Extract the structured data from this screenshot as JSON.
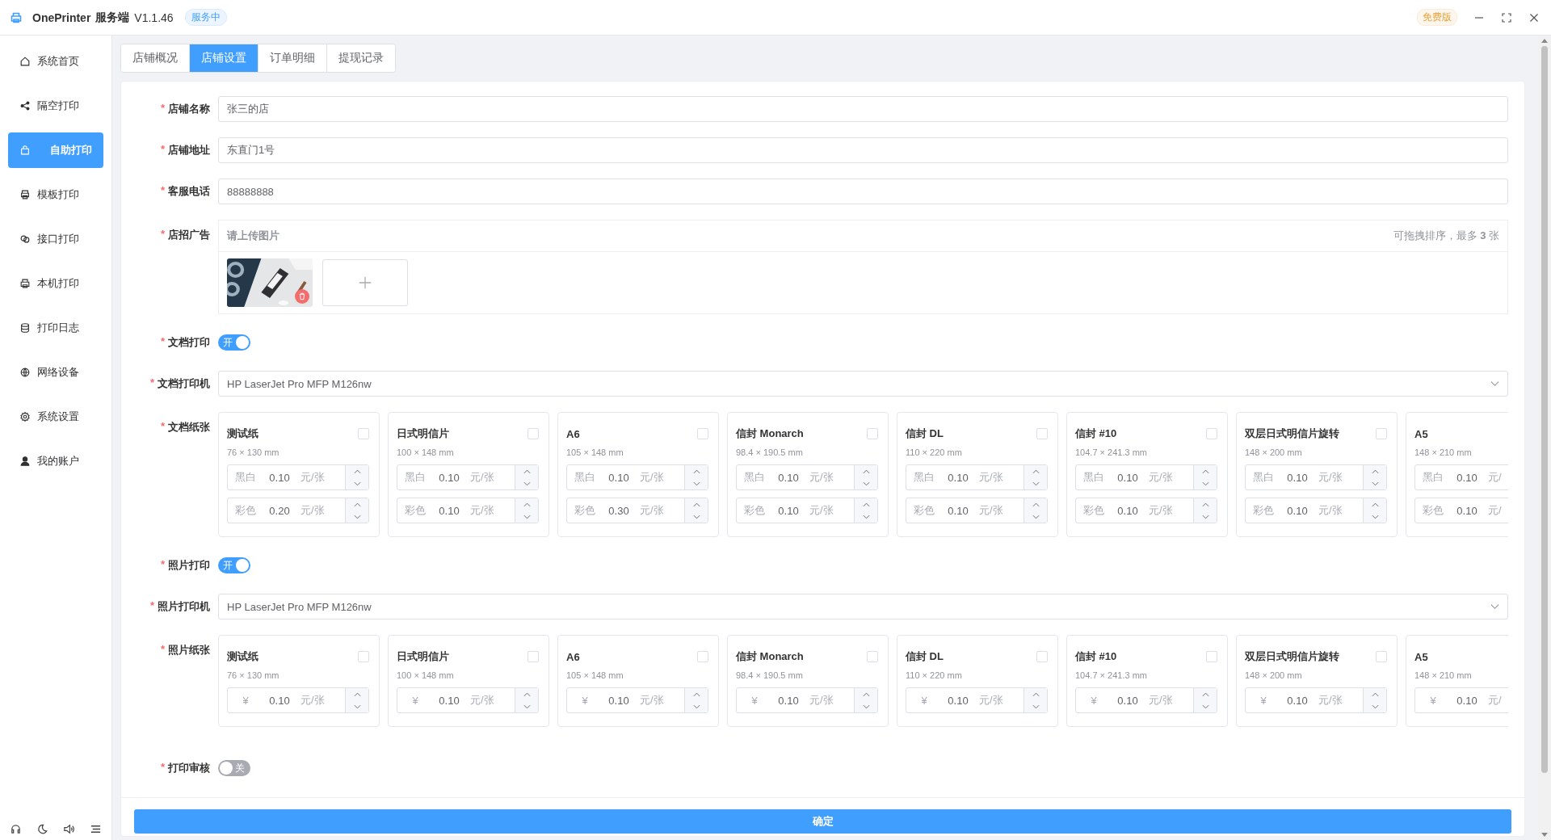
{
  "app": {
    "title": "OnePrinter",
    "subtitle": "服务端",
    "version": "V1.1.46",
    "status": "服务中",
    "edition": "免费版"
  },
  "sidebar": {
    "items": [
      {
        "kind": "home",
        "label": "系统首页",
        "selected": false
      },
      {
        "kind": "share",
        "label": "隔空打印",
        "selected": false
      },
      {
        "kind": "bag",
        "label": "自助打印",
        "selected": true
      },
      {
        "kind": "template",
        "label": "模板打印",
        "selected": false
      },
      {
        "kind": "link",
        "label": "接口打印",
        "selected": false
      },
      {
        "kind": "printer",
        "label": "本机打印",
        "selected": false
      },
      {
        "kind": "database",
        "label": "打印日志",
        "selected": false
      },
      {
        "kind": "network",
        "label": "网络设备",
        "selected": false
      },
      {
        "kind": "gear",
        "label": "系统设置",
        "selected": false
      },
      {
        "kind": "user",
        "label": "我的账户",
        "selected": false
      }
    ]
  },
  "tabs": [
    {
      "label": "店铺概况",
      "selected": false
    },
    {
      "label": "店铺设置",
      "selected": true
    },
    {
      "label": "订单明细",
      "selected": false
    },
    {
      "label": "提现记录",
      "selected": false
    }
  ],
  "form": {
    "fields": [
      {
        "mark": "*",
        "label": "店铺名称",
        "value": "张三的店"
      },
      {
        "mark": "*",
        "label": "店铺地址",
        "value": "东直门1号"
      },
      {
        "mark": "*",
        "label": "客服电话",
        "value": "88888888"
      }
    ],
    "banner": {
      "mark": "*",
      "label": "店招广告",
      "prompt": "请上传图片",
      "hint": "可拖拽排序，最多 **3** 张"
    },
    "doc_print": {
      "mark": "*",
      "label": "文档打印",
      "on": true,
      "text": "开"
    },
    "doc_printer": {
      "mark": "*",
      "label": "文档打印机",
      "value": "HP LaserJet Pro MFP M126nw"
    },
    "doc_papers": {
      "mark": "*",
      "label": "文档纸张",
      "items": [
        {
          "name": "测试纸",
          "size": "76 × 130 mm",
          "checked": false,
          "prices": [
            {
              "label": "黑白",
              "value": "0.10",
              "unit": "元/张"
            },
            {
              "label": "彩色",
              "value": "0.20",
              "unit": "元/张"
            }
          ]
        },
        {
          "name": "日式明信片",
          "size": "100 × 148 mm",
          "checked": false,
          "prices": [
            {
              "label": "黑白",
              "value": "0.10",
              "unit": "元/张"
            },
            {
              "label": "彩色",
              "value": "0.10",
              "unit": "元/张"
            }
          ]
        },
        {
          "name": "A6",
          "size": "105 × 148 mm",
          "checked": false,
          "prices": [
            {
              "label": "黑白",
              "value": "0.10",
              "unit": "元/张"
            },
            {
              "label": "彩色",
              "value": "0.30",
              "unit": "元/张"
            }
          ]
        },
        {
          "name": "信封 Monarch",
          "size": "98.4 × 190.5 mm",
          "checked": false,
          "prices": [
            {
              "label": "黑白",
              "value": "0.10",
              "unit": "元/张"
            },
            {
              "label": "彩色",
              "value": "0.10",
              "unit": "元/张"
            }
          ]
        },
        {
          "name": "信封 DL",
          "size": "110 × 220 mm",
          "checked": false,
          "prices": [
            {
              "label": "黑白",
              "value": "0.10",
              "unit": "元/张"
            },
            {
              "label": "彩色",
              "value": "0.10",
              "unit": "元/张"
            }
          ]
        },
        {
          "name": "信封 #10",
          "size": "104.7 × 241.3 mm",
          "checked": false,
          "prices": [
            {
              "label": "黑白",
              "value": "0.10",
              "unit": "元/张"
            },
            {
              "label": "彩色",
              "value": "0.10",
              "unit": "元/张"
            }
          ]
        },
        {
          "name": "双层日式明信片旋转",
          "size": "148 × 200 mm",
          "checked": false,
          "prices": [
            {
              "label": "黑白",
              "value": "0.10",
              "unit": "元/张"
            },
            {
              "label": "彩色",
              "value": "0.10",
              "unit": "元/张"
            }
          ]
        },
        {
          "name": "A5",
          "size": "148 × 210 mm",
          "prices": [
            {
              "label": "黑白",
              "value": "0.10",
              "unit": "元/"
            },
            {
              "label": "彩色",
              "value": "0.10",
              "unit": "元/"
            }
          ]
        }
      ]
    },
    "photo_print": {
      "mark": "*",
      "label": "照片打印",
      "on": true,
      "text": "开"
    },
    "photo_printer": {
      "mark": "*",
      "label": "照片打印机",
      "value": "HP LaserJet Pro MFP M126nw"
    },
    "photo_papers": {
      "mark": "*",
      "label": "照片纸张",
      "items": [
        {
          "name": "测试纸",
          "size": "76 × 130 mm",
          "checked": false,
          "prices": [
            {
              "label": "¥",
              "value": "0.10",
              "unit": "元/张"
            }
          ]
        },
        {
          "name": "日式明信片",
          "size": "100 × 148 mm",
          "checked": false,
          "prices": [
            {
              "label": "¥",
              "value": "0.10",
              "unit": "元/张"
            }
          ]
        },
        {
          "name": "A6",
          "size": "105 × 148 mm",
          "checked": false,
          "prices": [
            {
              "label": "¥",
              "value": "0.10",
              "unit": "元/张"
            }
          ]
        },
        {
          "name": "信封 Monarch",
          "size": "98.4 × 190.5 mm",
          "checked": false,
          "prices": [
            {
              "label": "¥",
              "value": "0.10",
              "unit": "元/张"
            }
          ]
        },
        {
          "name": "信封 DL",
          "size": "110 × 220 mm",
          "checked": false,
          "prices": [
            {
              "label": "¥",
              "value": "0.10",
              "unit": "元/张"
            }
          ]
        },
        {
          "name": "信封 #10",
          "size": "104.7 × 241.3 mm",
          "checked": false,
          "prices": [
            {
              "label": "¥",
              "value": "0.10",
              "unit": "元/张"
            }
          ]
        },
        {
          "name": "双层日式明信片旋转",
          "size": "148 × 200 mm",
          "checked": false,
          "prices": [
            {
              "label": "¥",
              "value": "0.10",
              "unit": "元/张"
            }
          ]
        },
        {
          "name": "A5",
          "size": "148 × 210 mm",
          "prices": [
            {
              "label": "¥",
              "value": "0.10",
              "unit": "元/"
            }
          ]
        }
      ]
    },
    "review": {
      "mark": "*",
      "label": "打印审核",
      "on": false,
      "text": "关"
    },
    "submit": "确定"
  }
}
